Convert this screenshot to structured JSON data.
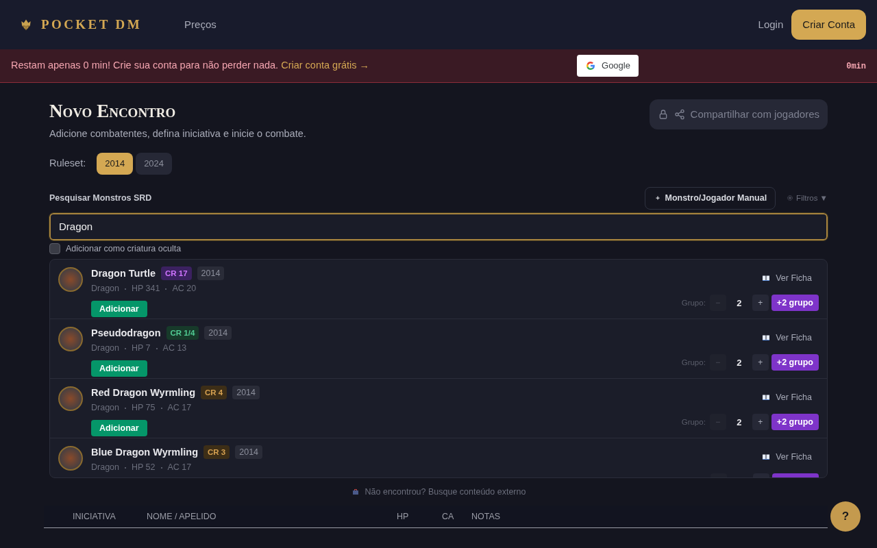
{
  "header": {
    "logo": "POCKET DM",
    "nav": [
      "Preços"
    ],
    "login": "Login",
    "signup": "Criar Conta"
  },
  "banner": {
    "message": "Restam apenas 0 min! Crie sua conta para não perder nada.",
    "link": "Criar conta grátis →",
    "google": "Google",
    "timer": "0min"
  },
  "page": {
    "title": "Novo Encontro",
    "subtitle": "Adicione combatentes, defina iniciativa e inicie o combate.",
    "share": "Compartilhar com jogadores"
  },
  "ruleset": {
    "label": "Ruleset:",
    "options": [
      {
        "label": "2014",
        "selected": true
      },
      {
        "label": "2024",
        "selected": false
      }
    ]
  },
  "search": {
    "label": "Pesquisar Monstros SRD",
    "manual": "Monstro/Jogador Manual",
    "filters": "Filtros ▼",
    "value": "Dragon",
    "hidden_label": "Adicionar como criatura oculta",
    "hidden_checked": false
  },
  "results": [
    {
      "name": "Dragon Turtle",
      "cr": "CR 17",
      "color": "#3b2160",
      "edition": "2014",
      "type": "Dragon",
      "hp": "HP 341",
      "ac": "AC 20",
      "add": "Adicionar",
      "view": "Ver Ficha",
      "group_label": "Grupo:",
      "minus": "−",
      "count": "2",
      "plus": "+",
      "group_add": "+2 grupo"
    },
    {
      "name": "Pseudodragon",
      "cr": "CR 1/4",
      "color": "#173a2a",
      "edition": "2014",
      "type": "Dragon",
      "hp": "HP 7",
      "ac": "AC 13",
      "add": "Adicionar",
      "view": "Ver Ficha",
      "group_label": "Grupo:",
      "minus": "−",
      "count": "2",
      "plus": "+",
      "group_add": "+2 grupo"
    },
    {
      "name": "Red Dragon Wyrmling",
      "cr": "CR 4",
      "color": "#3d2e17",
      "edition": "2014",
      "type": "Dragon",
      "hp": "HP 75",
      "ac": "AC 17",
      "add": "Adicionar",
      "view": "Ver Ficha",
      "group_label": "Grupo:",
      "minus": "−",
      "count": "2",
      "plus": "+",
      "group_add": "+2 grupo"
    },
    {
      "name": "Blue Dragon Wyrmling",
      "cr": "CR 3",
      "color": "#3d2e17",
      "edition": "2014",
      "type": "Dragon",
      "hp": "HP 52",
      "ac": "AC 17",
      "view": "Ver Ficha"
    }
  ],
  "external": "Não encontrou? Busque conteúdo externo",
  "table": {
    "columns": [
      "INICIATIVA",
      "NOME / APELIDO",
      "HP",
      "CA",
      "NOTAS"
    ]
  },
  "help": "?"
}
